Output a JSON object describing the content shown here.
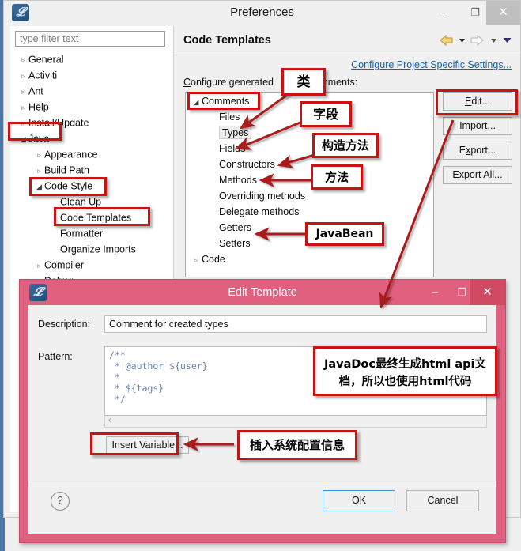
{
  "window": {
    "title": "Preferences",
    "icon": "eclipse-icon",
    "minimize": "–",
    "maximize": "❐",
    "close": "✕"
  },
  "sidebar": {
    "filter_placeholder": "type filter text",
    "filter_value": "",
    "items": [
      {
        "label": "General",
        "indent": 0,
        "state": "collapsed"
      },
      {
        "label": "Activiti",
        "indent": 0,
        "state": "collapsed"
      },
      {
        "label": "Ant",
        "indent": 0,
        "state": "collapsed"
      },
      {
        "label": "Help",
        "indent": 0,
        "state": "collapsed"
      },
      {
        "label": "Install/Update",
        "indent": 0,
        "state": "collapsed"
      },
      {
        "label": "Java",
        "indent": 0,
        "state": "expanded"
      },
      {
        "label": "Appearance",
        "indent": 1,
        "state": "collapsed"
      },
      {
        "label": "Build Path",
        "indent": 1,
        "state": "collapsed"
      },
      {
        "label": "Code Style",
        "indent": 1,
        "state": "expanded"
      },
      {
        "label": "Clean Up",
        "indent": 2,
        "state": "leaf"
      },
      {
        "label": "Code Templates",
        "indent": 2,
        "state": "leaf"
      },
      {
        "label": "Formatter",
        "indent": 2,
        "state": "leaf"
      },
      {
        "label": "Organize Imports",
        "indent": 2,
        "state": "leaf"
      },
      {
        "label": "Compiler",
        "indent": 1,
        "state": "collapsed"
      },
      {
        "label": "Debug",
        "indent": 1,
        "state": "collapsed"
      }
    ]
  },
  "content": {
    "page_title": "Code Templates",
    "nav": {
      "back": "back-arrow",
      "back_menu": "chevron-down",
      "forward": "forward-arrow",
      "forward_menu": "chevron-down",
      "view_menu": "chevron-down"
    },
    "project_settings_link": "Configure Project Specific Settings...",
    "generated_label_prefix": "C",
    "generated_label": "onfigure generated",
    "generated_label_suffix": "comments:",
    "template_tree": [
      {
        "label": "Comments",
        "indent": 0,
        "state": "expanded",
        "selected": false
      },
      {
        "label": "Files",
        "indent": 1,
        "state": "leaf",
        "selected": false
      },
      {
        "label": "Types",
        "indent": 1,
        "state": "leaf",
        "selected": true
      },
      {
        "label": "Fields",
        "indent": 1,
        "state": "leaf",
        "selected": false
      },
      {
        "label": "Constructors",
        "indent": 1,
        "state": "leaf",
        "selected": false
      },
      {
        "label": "Methods",
        "indent": 1,
        "state": "leaf",
        "selected": false
      },
      {
        "label": "Overriding methods",
        "indent": 1,
        "state": "leaf",
        "selected": false
      },
      {
        "label": "Delegate methods",
        "indent": 1,
        "state": "leaf",
        "selected": false
      },
      {
        "label": "Getters",
        "indent": 1,
        "state": "leaf",
        "selected": false
      },
      {
        "label": "Setters",
        "indent": 1,
        "state": "leaf",
        "selected": false
      },
      {
        "label": "Code",
        "indent": 0,
        "state": "collapsed",
        "selected": false
      }
    ],
    "buttons": [
      {
        "pre": "E",
        "mid": "dit...",
        "post": ""
      },
      {
        "pre": "I",
        "mid": "m",
        "post": "port..."
      },
      {
        "pre": "E",
        "mid": "x",
        "post": "port..."
      },
      {
        "pre": "Ex",
        "mid": "p",
        "post": "ort All..."
      }
    ],
    "button_labels": [
      "Edit...",
      "Import...",
      "Export...",
      "Export All..."
    ]
  },
  "dialog": {
    "title": "Edit Template",
    "icon": "eclipse-icon",
    "minimize": "–",
    "maximize": "❐",
    "close": "✕",
    "description_label": "Description:",
    "description_value": "Comment for created types",
    "pattern_label": "Pattern:",
    "pattern_value": "/**\n * @author ${user}\n *\n * ${tags}\n */",
    "scroll_left_icon": "‹",
    "scroll_up_icon": "▲",
    "insert_variable_label": "Insert Variable...",
    "help_label": "?",
    "ok_label": "OK",
    "cancel_label": "Cancel"
  },
  "annotations": {
    "accent_color": "#cc1111",
    "boxes": [
      {
        "id": "class",
        "text": "类"
      },
      {
        "id": "field",
        "text": "字段"
      },
      {
        "id": "constructor",
        "text": "构造方法"
      },
      {
        "id": "method",
        "text": "方法"
      },
      {
        "id": "javabean",
        "text": "JavaBean"
      },
      {
        "id": "javadoc",
        "text": "JavaDoc最终生成html api文档，所以也使用html代码"
      },
      {
        "id": "insert-var",
        "text": "插入系统配置信息"
      }
    ]
  }
}
